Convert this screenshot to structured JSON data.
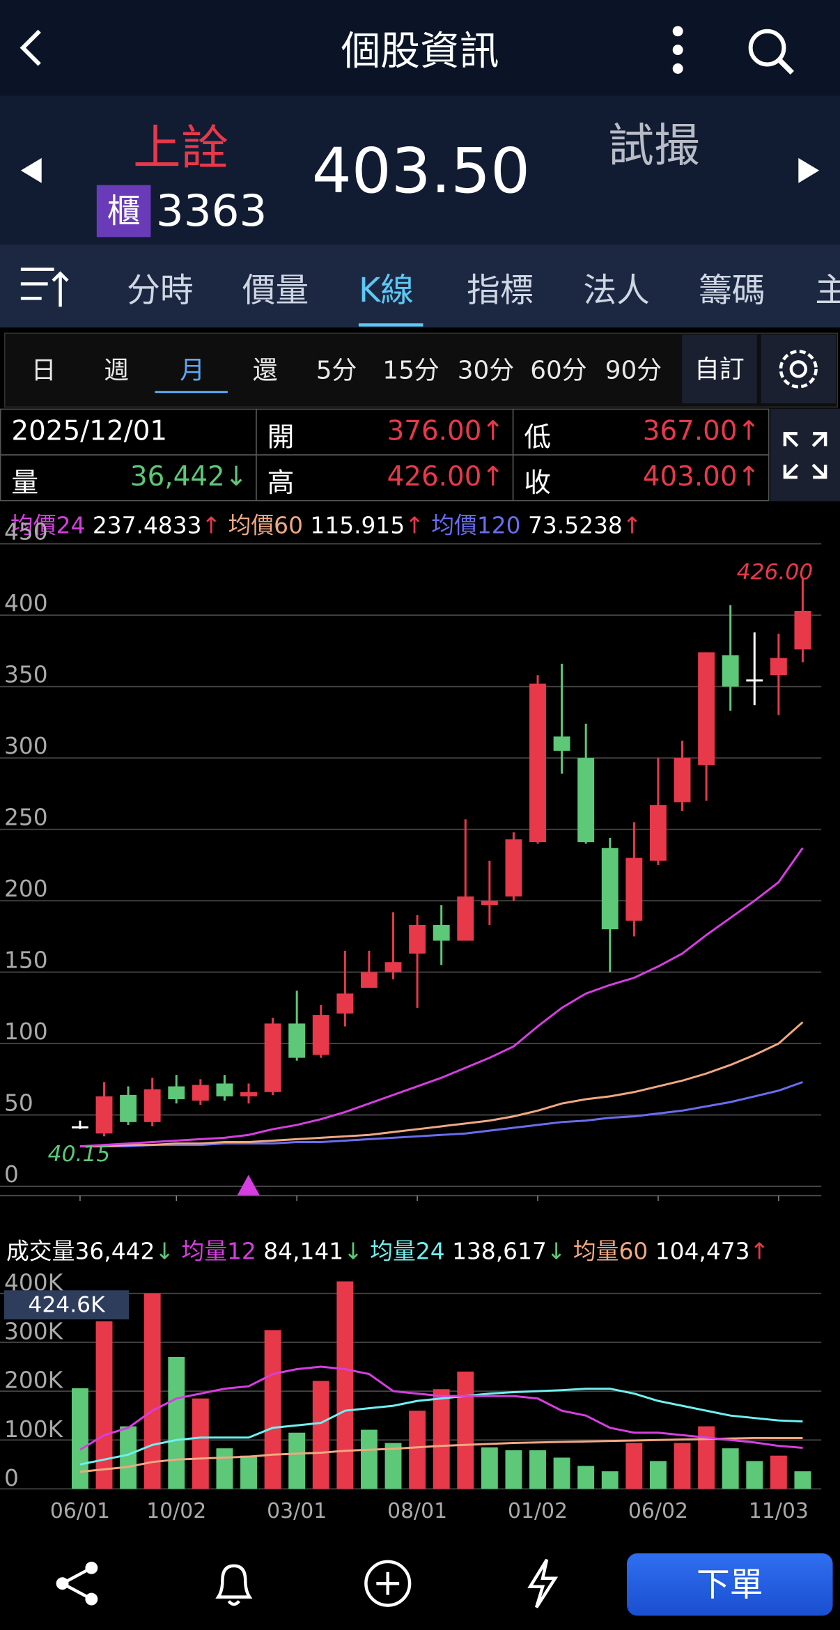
{
  "header": {
    "title": "個股資訊"
  },
  "stock": {
    "name": "上詮",
    "market_badge": "櫃",
    "code": "3363",
    "price": "403.50",
    "status": "試撮"
  },
  "tabs": [
    "分時",
    "價量",
    "K線",
    "指標",
    "法人",
    "籌碼",
    "主"
  ],
  "active_tab": "K線",
  "periods": [
    "日",
    "週",
    "月",
    "還",
    "5分",
    "15分",
    "30分",
    "60分",
    "90分"
  ],
  "active_period": "月",
  "custom_label": "自訂",
  "quote": {
    "date": "2025/12/01",
    "open_label": "開",
    "open": "376.00↑",
    "low_label": "低",
    "low": "367.00↑",
    "vol_label": "量",
    "vol": "36,442↓",
    "high_label": "高",
    "high": "426.00↑",
    "close_label": "收",
    "close": "403.00↑"
  },
  "ma_legend": [
    {
      "label": "均價24",
      "value": "237.4833",
      "arrow": "↑",
      "color": "#d63ee0"
    },
    {
      "label": "均價60",
      "value": "115.915",
      "arrow": "↑",
      "color": "#f0a882"
    },
    {
      "label": "均價120",
      "value": "73.5238",
      "arrow": "↑",
      "color": "#6a6df0"
    }
  ],
  "vol_legend": {
    "label": "成交量",
    "value": "36,442",
    "arrow": "↓",
    "items": [
      {
        "label": "均量12",
        "value": "84,141",
        "arrow": "↓",
        "color": "#d63ee0"
      },
      {
        "label": "均量24",
        "value": "138,617",
        "arrow": "↓",
        "color": "#6ff0f0"
      },
      {
        "label": "均量60",
        "value": "104,473",
        "arrow": "↑",
        "color": "#f0a882"
      }
    ]
  },
  "chart_data": {
    "type": "candlestick",
    "x_labels": [
      {
        "i": 0,
        "t": "06/01"
      },
      {
        "i": 4,
        "t": "10/02"
      },
      {
        "i": 9,
        "t": "03/01"
      },
      {
        "i": 14,
        "t": "08/01"
      },
      {
        "i": 19,
        "t": "01/02"
      },
      {
        "i": 24,
        "t": "06/02"
      },
      {
        "i": 29,
        "t": "11/03"
      }
    ],
    "y_ticks": [
      0,
      50,
      100,
      150,
      200,
      250,
      300,
      350,
      400,
      450
    ],
    "ylim": [
      0,
      450
    ],
    "max_label": "426.00",
    "min_label": "40.15",
    "ohlc": [
      [
        42,
        46,
        40.15,
        42
      ],
      [
        37,
        73,
        35,
        63
      ],
      [
        64,
        70,
        43,
        45
      ],
      [
        45,
        76,
        42,
        68
      ],
      [
        70,
        78,
        58,
        61
      ],
      [
        60,
        75,
        57,
        71
      ],
      [
        72,
        78,
        60,
        63
      ],
      [
        63,
        72,
        58,
        66
      ],
      [
        66,
        118,
        64,
        114
      ],
      [
        114,
        137,
        88,
        90
      ],
      [
        92,
        127,
        90,
        120
      ],
      [
        121,
        165,
        112,
        135
      ],
      [
        139,
        165,
        140,
        150
      ],
      [
        150,
        192,
        145,
        157
      ],
      [
        163,
        190,
        125,
        183
      ],
      [
        183,
        197,
        155,
        172
      ],
      [
        172,
        257,
        180,
        203
      ],
      [
        197,
        228,
        183,
        200
      ],
      [
        203,
        248,
        200,
        243
      ],
      [
        241,
        358,
        240,
        352
      ],
      [
        315,
        366,
        289,
        305
      ],
      [
        300,
        324,
        240,
        241
      ],
      [
        237,
        244,
        150,
        180
      ],
      [
        186,
        255,
        175,
        230
      ],
      [
        228,
        300,
        225,
        267
      ],
      [
        269,
        312,
        263,
        300
      ],
      [
        295,
        374,
        270,
        374
      ],
      [
        372,
        407,
        333,
        350
      ],
      [
        355,
        388,
        337,
        355
      ],
      [
        358,
        387,
        330,
        370
      ],
      [
        376,
        426,
        367,
        403
      ]
    ],
    "ma24": [
      28,
      29,
      30,
      31,
      32,
      33,
      34,
      36,
      40,
      43,
      47,
      52,
      58,
      64,
      70,
      76,
      83,
      90,
      98,
      112,
      125,
      135,
      141,
      146,
      154,
      163,
      176,
      188,
      200,
      213,
      237
    ],
    "ma60": [
      28,
      28,
      29,
      29,
      30,
      30,
      31,
      31,
      32,
      33,
      34,
      35,
      36,
      38,
      40,
      42,
      44,
      46,
      49,
      53,
      58,
      61,
      63,
      66,
      70,
      74,
      79,
      85,
      92,
      100,
      115
    ],
    "ma120": [
      28,
      28,
      28,
      29,
      29,
      29,
      30,
      30,
      30,
      31,
      31,
      32,
      33,
      34,
      35,
      36,
      37,
      39,
      41,
      43,
      45,
      46,
      48,
      49,
      51,
      53,
      56,
      59,
      63,
      67,
      73
    ],
    "volume_k": [
      206,
      343,
      128,
      400,
      270,
      185,
      83,
      68,
      325,
      115,
      221,
      424.6,
      121,
      94,
      160,
      204,
      240,
      85,
      79,
      79,
      64,
      47,
      36,
      94,
      57,
      94,
      128,
      83,
      57,
      68,
      36
    ],
    "volume_up": [
      0,
      1,
      0,
      1,
      0,
      1,
      0,
      0,
      1,
      0,
      1,
      1,
      0,
      0,
      1,
      1,
      1,
      0,
      0,
      0,
      0,
      0,
      0,
      1,
      0,
      1,
      1,
      0,
      0,
      1,
      0
    ],
    "vol_ma12": [
      80,
      110,
      125,
      160,
      185,
      195,
      205,
      210,
      235,
      245,
      250,
      245,
      235,
      200,
      195,
      190,
      190,
      190,
      190,
      185,
      160,
      150,
      125,
      115,
      115,
      110,
      105,
      100,
      95,
      88,
      84
    ],
    "vol_ma24": [
      50,
      60,
      70,
      90,
      100,
      105,
      105,
      105,
      125,
      130,
      135,
      160,
      165,
      170,
      180,
      185,
      190,
      195,
      198,
      200,
      202,
      205,
      205,
      195,
      180,
      170,
      160,
      150,
      145,
      140,
      138
    ],
    "vol_ma60": [
      35,
      40,
      45,
      55,
      60,
      62,
      64,
      66,
      70,
      72,
      74,
      78,
      80,
      82,
      85,
      88,
      90,
      92,
      94,
      95,
      96,
      97,
      98,
      99,
      100,
      101,
      102,
      103,
      104,
      104,
      104
    ],
    "vol_y_ticks": [
      "0",
      "100K",
      "200K",
      "300K",
      "400K"
    ],
    "vol_max_label": "424.6K"
  },
  "bottom": {
    "order_label": "下單"
  }
}
